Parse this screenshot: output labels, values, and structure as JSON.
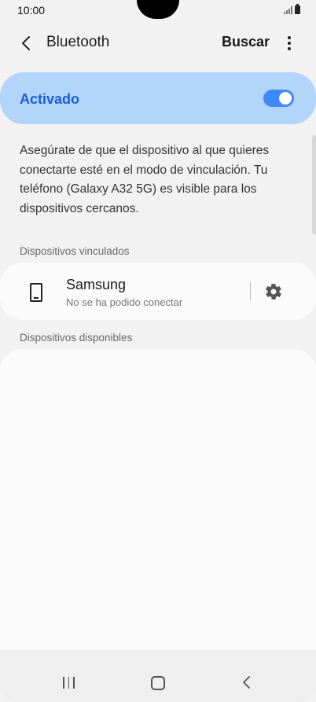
{
  "status_bar": {
    "time": "10:00",
    "icons": [
      "signal-icon",
      "battery-icon"
    ]
  },
  "header": {
    "title": "Bluetooth",
    "back_icon": "chevron-left-icon",
    "search_label": "Buscar",
    "more_icon": "more-vertical-icon"
  },
  "master_switch": {
    "label": "Activado",
    "state": "on",
    "accent_color": "#3e8af6",
    "card_color": "#b3d4fb",
    "label_color": "#1a5fd1"
  },
  "description": "Asegúrate de que el dispositivo al que quieres conectarte esté en el modo de vinculación. Tu teléfono (Galaxy A32 5G) es visible para los dispositivos cercanos.",
  "paired_section": {
    "title": "Dispositivos vinculados",
    "devices": [
      {
        "name": "Samsung",
        "status": "No se ha podido conectar",
        "icon": "smartphone-icon",
        "settings_icon": "gear-icon"
      }
    ]
  },
  "available_section": {
    "title": "Dispositivos disponibles",
    "devices": []
  },
  "nav_bar": {
    "recent_icon": "recent-apps-icon",
    "home_icon": "home-icon",
    "back_icon": "nav-back-icon"
  }
}
